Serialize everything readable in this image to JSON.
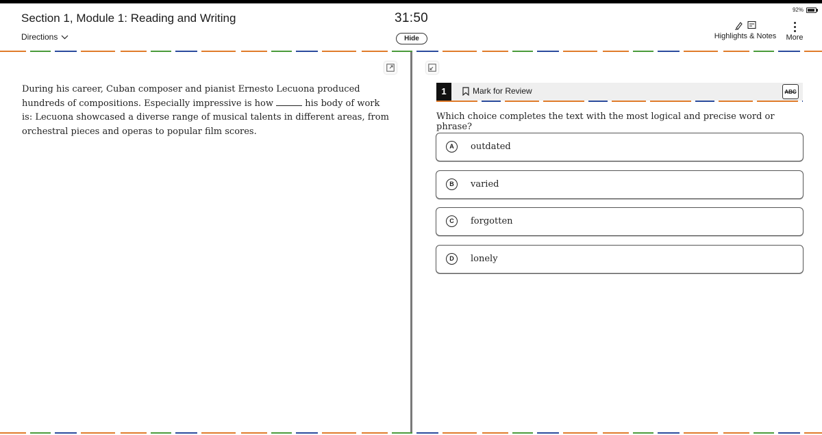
{
  "status": {
    "battery": "92%"
  },
  "header": {
    "section_title": "Section 1, Module 1: Reading and Writing",
    "directions_label": "Directions",
    "timer": "31:50",
    "hide_label": "Hide",
    "highlights_label": "Highlights & Notes",
    "more_label": "More"
  },
  "passage": {
    "before_blank": "During his career, Cuban composer and pianist Ernesto Lecuona produced hundreds of compositions. Especially impressive is how ",
    "after_blank": " his body of work is: Lecuona showcased a diverse range of musical talents in different areas, from orchestral pieces and operas to popular film scores."
  },
  "question": {
    "number": "1",
    "mark_label": "Mark for Review",
    "abc_label": "ABC",
    "prompt": "Which choice completes the text with the most logical and precise word or phrase?",
    "choices": [
      {
        "letter": "A",
        "text": "outdated"
      },
      {
        "letter": "B",
        "text": "varied"
      },
      {
        "letter": "C",
        "text": "forgotten"
      },
      {
        "letter": "D",
        "text": "lonely"
      }
    ]
  }
}
